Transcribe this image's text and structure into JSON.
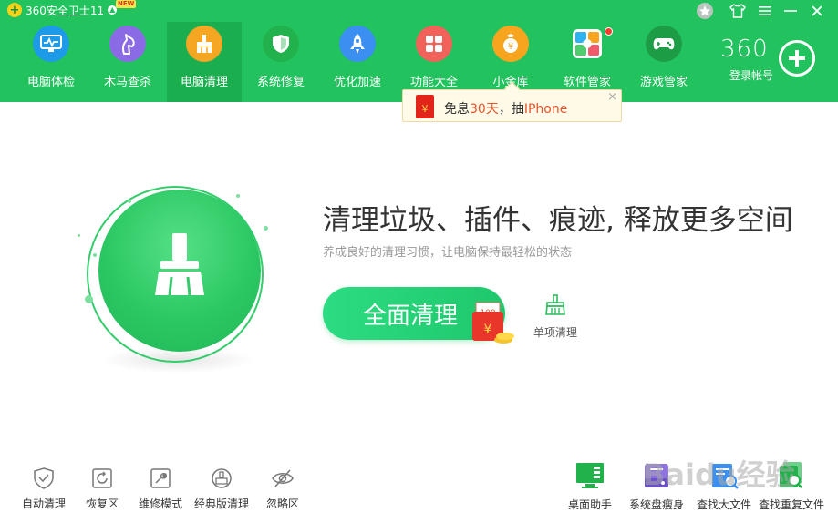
{
  "window": {
    "title": "360安全卫士11",
    "new_badge": "NEW",
    "controls": [
      {
        "name": "skin-icon",
        "glyph": "★"
      },
      {
        "name": "shirt-icon",
        "glyph": "👕"
      },
      {
        "name": "menu-icon",
        "glyph": "☰"
      },
      {
        "name": "minimize-icon",
        "glyph": "—"
      },
      {
        "name": "close-icon",
        "glyph": "✕"
      }
    ]
  },
  "nav": {
    "items": [
      {
        "label": "电脑体检",
        "icon": "monitor-icon",
        "color": "#1e9be8"
      },
      {
        "label": "木马查杀",
        "icon": "horse-icon",
        "color": "#8b6ae6"
      },
      {
        "label": "电脑清理",
        "icon": "broom-icon",
        "color": "#f5a623",
        "active": true
      },
      {
        "label": "系统修复",
        "icon": "shield-icon",
        "color": "#21b24e"
      },
      {
        "label": "优化加速",
        "icon": "rocket-icon",
        "color": "#3b8ff0"
      },
      {
        "label": "功能大全",
        "icon": "grid-icon",
        "color": "#f2625b"
      },
      {
        "label": "小金库",
        "icon": "coin-icon",
        "color": "#f7a51f"
      },
      {
        "label": "软件管家",
        "icon": "apps-icon",
        "color": "#ffffff"
      },
      {
        "label": "游戏管家",
        "icon": "gamepad-icon",
        "color": "#1c9c45"
      }
    ]
  },
  "account": {
    "brand": "360",
    "login_label": "登录帐号"
  },
  "promo": {
    "prefix": "免息",
    "days": "30天",
    "middle": "，抽",
    "prize": "IPhone"
  },
  "hero": {
    "headline": "清理垃圾、插件、痕迹, 释放更多空间",
    "subline": "养成良好的清理习惯，让电脑保持最轻松的状态",
    "main_button": "全面清理",
    "reward_amount": "100",
    "single_clean": "单项清理"
  },
  "bottom_left": [
    {
      "label": "自动清理",
      "icon": "shield-check-icon"
    },
    {
      "label": "恢复区",
      "icon": "restore-icon"
    },
    {
      "label": "维修模式",
      "icon": "wrench-icon"
    },
    {
      "label": "经典版清理",
      "icon": "classic-clean-icon"
    },
    {
      "label": "忽略区",
      "icon": "eye-off-icon"
    }
  ],
  "bottom_right": [
    {
      "label": "桌面助手",
      "icon": "desktop-assistant-icon",
      "color": "#22b24c"
    },
    {
      "label": "系统盘瘦身",
      "icon": "disk-slim-icon",
      "color": "#7a5bd6"
    },
    {
      "label": "查找大文件",
      "icon": "find-large-file-icon",
      "color": "#3b8ff0"
    },
    {
      "label": "查找重复文件",
      "icon": "find-duplicate-icon",
      "color": "#22b24c"
    }
  ],
  "watermark": "Baidu经验"
}
